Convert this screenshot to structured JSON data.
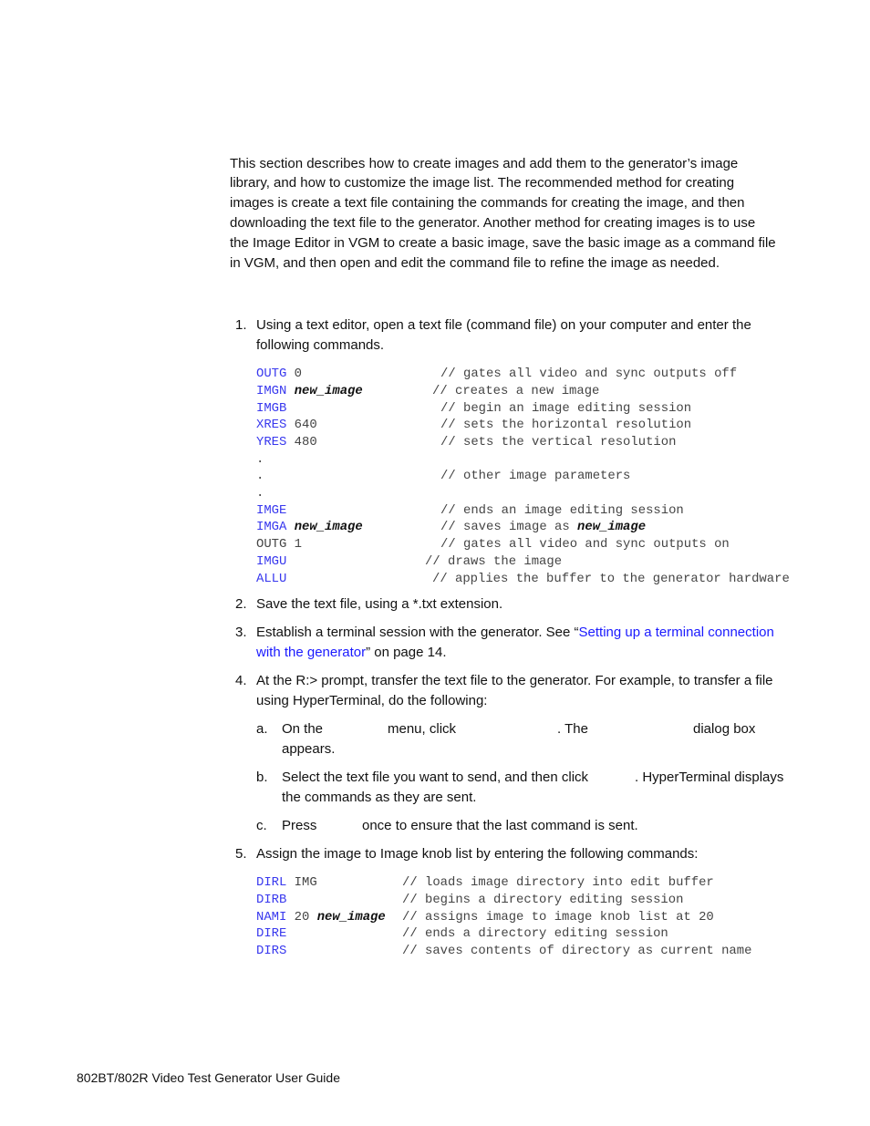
{
  "intro": [
    "This section describes how to create images and add them to the generator’s image",
    "library, and how to customize the image list. The recommended method for creating",
    "images is create a text file containing the commands for creating the image, and then",
    "downloading the text file to the generator. Another method for creating images is to use",
    "the Image Editor in VGM to create a basic image, save the basic image as a command file",
    "in VGM, and then open and edit the command file to refine the image as needed."
  ],
  "steps": {
    "s1": {
      "num": "1.",
      "lines": [
        "Using a text editor, open a text file (command file) on your computer and enter the",
        "following commands."
      ]
    },
    "s2": {
      "num": "2.",
      "lines": [
        "Save the text file, using a *.txt extension."
      ]
    },
    "s3": {
      "num": "3.",
      "pre": "Establish a terminal session with the generator. See “",
      "link1": "Setting up a terminal connection",
      "link2": "with the generator",
      "post": "” on page 14."
    },
    "s4": {
      "num": "4.",
      "lines": [
        "At the R:> prompt, transfer the text file to the generator. For example, to transfer a file",
        "using HyperTerminal, do the following:"
      ]
    },
    "s4a": {
      "letter": "a.",
      "p1": "On the",
      "p2": "menu, click",
      "p3": ". The",
      "p4": "dialog box",
      "p5": "appears."
    },
    "s4b": {
      "letter": "b.",
      "p1": "Select the text file you want to send, and then click",
      "p2": ". HyperTerminal displays",
      "p3": "the commands as they are sent."
    },
    "s4c": {
      "letter": "c.",
      "p1": "Press",
      "p2": "once to ensure that the last command is sent."
    },
    "s5": {
      "num": "5.",
      "lines": [
        "Assign the image to Image knob list by entering the following commands:"
      ]
    }
  },
  "code1": [
    {
      "cmd": "OUTG",
      "arg": " 0",
      "bold": "",
      "comment": "// gates all video and sync outputs off"
    },
    {
      "cmd": "IMGN",
      "arg": " ",
      "bold": "new_image",
      "comment": "// creates a new image"
    },
    {
      "cmd": "IMGB",
      "arg": "",
      "bold": "",
      "comment": "// begin an image editing session"
    },
    {
      "cmd": "XRES",
      "arg": " 640",
      "bold": "",
      "comment": "// sets the horizontal resolution"
    },
    {
      "cmd": "YRES",
      "arg": " 480",
      "bold": "",
      "comment": "// sets the vertical resolution"
    },
    {
      "cmd": "",
      "arg": ".",
      "bold": "",
      "comment": ""
    },
    {
      "cmd": "",
      "arg": ".",
      "bold": "",
      "comment": "// other image parameters"
    },
    {
      "cmd": "",
      "arg": ".",
      "bold": "",
      "comment": ""
    },
    {
      "cmd": "IMGE",
      "arg": "",
      "bold": "",
      "comment": "// ends an image editing session"
    },
    {
      "cmd": "IMGA",
      "arg": " ",
      "bold": "new_image",
      "comment": "// saves image as ",
      "comment_bold": "new_image"
    },
    {
      "cmd": "",
      "arg": "OUTG 1",
      "bold": "",
      "comment": "// gates all video and sync outputs on"
    },
    {
      "cmd": "IMGU",
      "arg": "",
      "bold": "",
      "comment": "// draws the image"
    },
    {
      "cmd": "ALLU",
      "arg": "",
      "bold": "",
      "comment": "// applies the buffer to the generator hardware"
    }
  ],
  "code2": [
    {
      "cmd": "DIRL",
      "arg": " IMG",
      "bold": "",
      "comment": "// loads image directory into edit buffer"
    },
    {
      "cmd": "DIRB",
      "arg": "",
      "bold": "",
      "comment": "// begins a directory editing session"
    },
    {
      "cmd": "NAMI",
      "arg": " 20 ",
      "bold": "new_image",
      "comment": "// assigns image to image knob list at 20"
    },
    {
      "cmd": "DIRE",
      "arg": "",
      "bold": "",
      "comment": "// ends a directory editing session"
    },
    {
      "cmd": "DIRS",
      "arg": "",
      "bold": "",
      "comment": "// saves contents of directory as current name"
    }
  ],
  "footer": "802BT/802R Video Test Generator User Guide",
  "colors": {
    "keyword": "#3838ee",
    "link": "#1a1aff",
    "text": "#111111"
  }
}
